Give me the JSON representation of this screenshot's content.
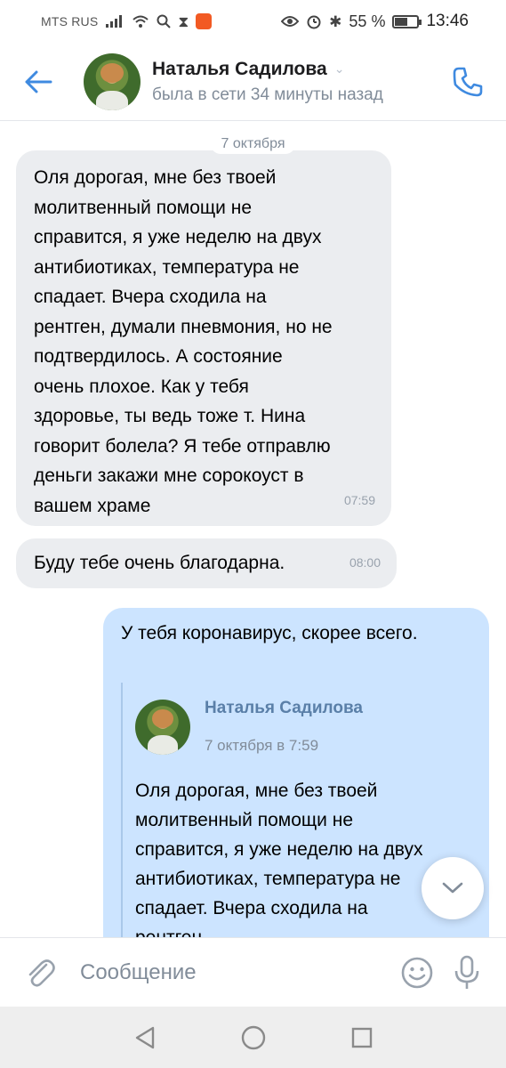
{
  "status_bar": {
    "carrier": "MTS RUS",
    "battery_percent": "55 %",
    "battery_level": 0.55,
    "time": "13:46",
    "icons": [
      "signal-icon",
      "wifi-icon",
      "search-icon",
      "hourglass-icon",
      "app-notification-icon",
      "eye-icon",
      "alarm-icon",
      "bluetooth-icon",
      "battery-icon"
    ]
  },
  "header": {
    "name": "Наталья Садилова",
    "status": "была в сети 34 минуты назад",
    "accent_color": "#3f8ae0"
  },
  "chat": {
    "date_label": "7 октября",
    "messages_in": [
      {
        "text": "Оля дорогая, мне без твоей молитвенный помощи не справится, я уже неделю на двух антибиотиках, температура не спадает. Вчера сходила на рентген, думали пневмония, но не подтвердилось. А состояние очень плохое. Как у тебя здоровье, ты ведь тоже т. Нина говорит болела? Я тебе отправлю деньги закажи мне сорокоуст в вашем храме",
        "time": "07:59"
      },
      {
        "text": "Буду тебе очень благодарна.",
        "time": "08:00"
      }
    ],
    "message_out": {
      "text": "У тебя коронавирус, скорее всего.",
      "reply": {
        "author": "Наталья Садилова",
        "date": "7 октября в 7:59",
        "text": "Оля дорогая, мне без твоей молитвенный помощи не справится, я уже неделю на двух антибиотиках, температура не спадает. Вчера сходила на рентген,"
      }
    }
  },
  "composer": {
    "placeholder": "Сообщение"
  },
  "colors": {
    "incoming_bubble": "#ebedf0",
    "outgoing_bubble": "#cce4ff",
    "secondary_text": "#818c99"
  }
}
